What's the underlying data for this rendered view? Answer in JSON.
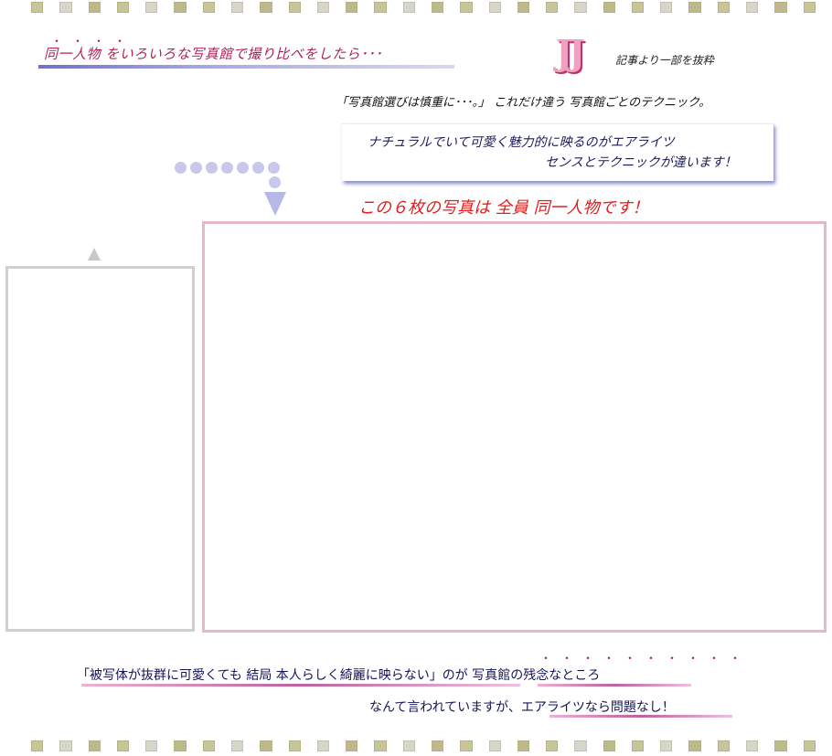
{
  "header": {
    "headline": "同一人物 をいろいろな写真館で撮り比べをしたら･･･",
    "emphasis_dots": "・・・・",
    "logo_text": "JJ",
    "logo_caption": "記事より一部を抜粋"
  },
  "subline": "「写真館選びは慎重に･･･。」 これだけ違う 写真館ごとのテクニック。",
  "callout": {
    "line1": "ナチュラルでいて可愛く魅力的に映るのがエアライツ",
    "line2": "センスとテクニックが違います！"
  },
  "main_caption": "この６枚の写真は 全員 同一人物です！",
  "footer": {
    "line1": "「被写体が抜群に可愛くても 結局 本人らしく綺麗に映らない」のが 写真館の残念なところ",
    "line1_dots": "・・・・・・・・・・",
    "line2": "なんて言われていますが、エアライツなら問題なし！"
  },
  "colors": {
    "accent_pink": "#b0205a",
    "caption_red": "#e02020",
    "text_navy": "#14145a",
    "dot_lavender": "#c8c8ec",
    "panel_border_pink": "#e4b8c6",
    "panel_border_gray": "#cfcfcf"
  },
  "icons": [
    "film-strip-top",
    "film-strip-bottom",
    "down-arrow-icon",
    "up-arrow-icon",
    "dot-trail-icon"
  ]
}
